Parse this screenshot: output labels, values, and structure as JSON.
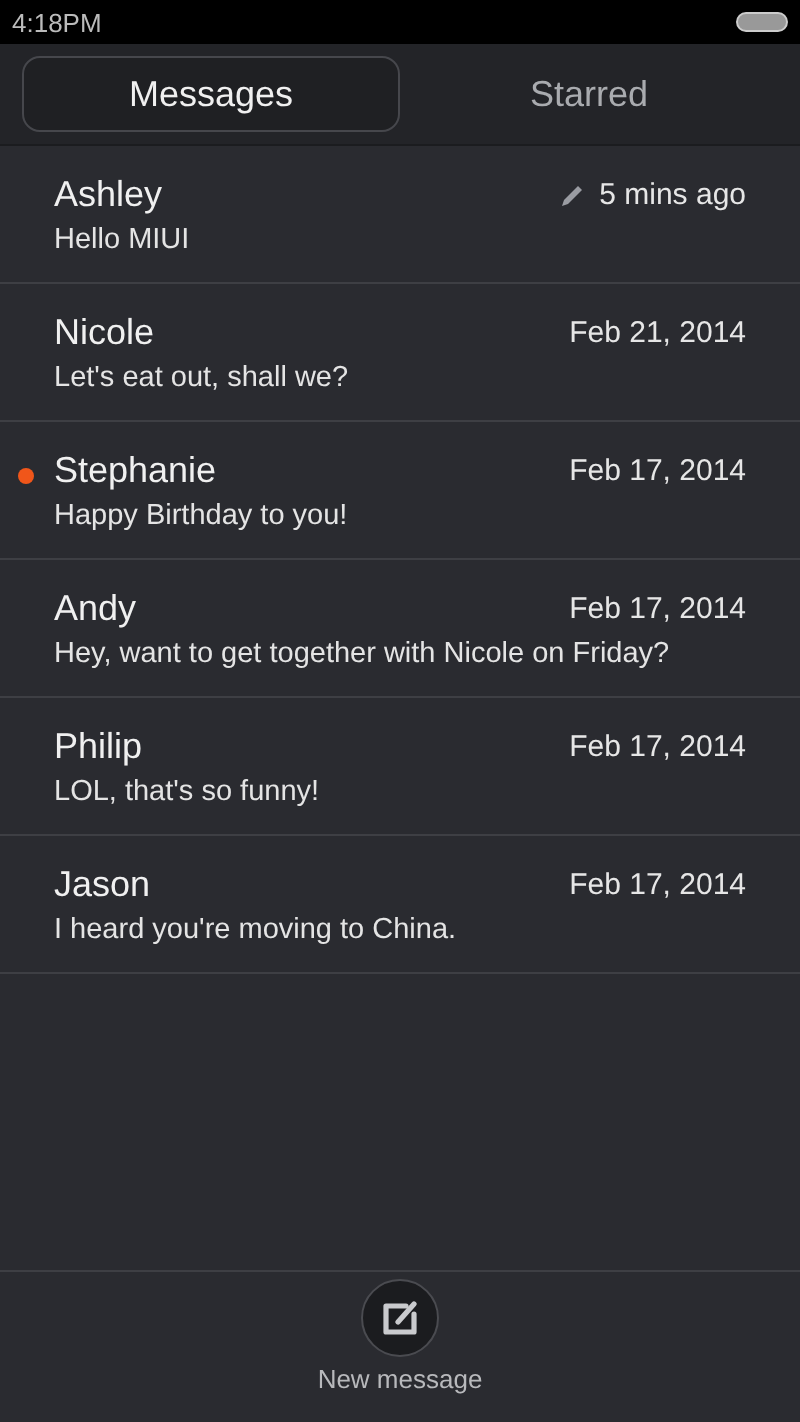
{
  "status_bar": {
    "time": "4:18PM"
  },
  "tabs": [
    {
      "label": "Messages",
      "selected": true
    },
    {
      "label": "Starred",
      "selected": false
    }
  ],
  "conversations": [
    {
      "name": "Ashley",
      "preview": "Hello MIUI",
      "time": "5 mins ago",
      "unread": false,
      "draft": true
    },
    {
      "name": "Nicole",
      "preview": "Let's eat out, shall we?",
      "time": "Feb 21, 2014",
      "unread": false,
      "draft": false
    },
    {
      "name": "Stephanie",
      "preview": "Happy Birthday to you!",
      "time": "Feb 17, 2014",
      "unread": true,
      "draft": false
    },
    {
      "name": "Andy",
      "preview": "Hey, want to get together with Nicole on Friday?",
      "time": "Feb 17, 2014",
      "unread": false,
      "draft": false
    },
    {
      "name": "Philip",
      "preview": "LOL, that's so funny!",
      "time": "Feb 17, 2014",
      "unread": false,
      "draft": false
    },
    {
      "name": "Jason",
      "preview": "I heard you're moving to China.",
      "time": "Feb 17, 2014",
      "unread": false,
      "draft": false
    }
  ],
  "new_message_button": {
    "label": "New message"
  }
}
